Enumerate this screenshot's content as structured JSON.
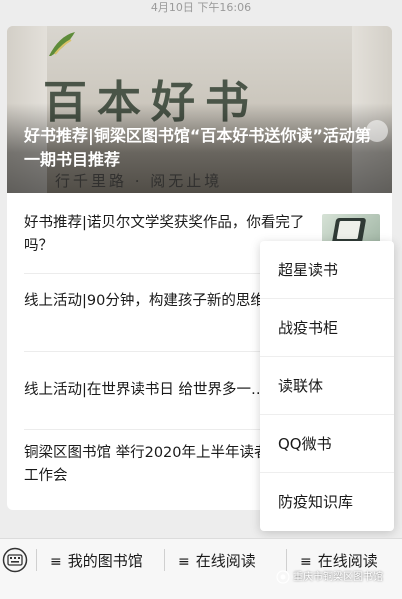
{
  "timestamp": "4月10日 下午16:06",
  "hero": {
    "image_text": "百本好书",
    "image_subtext": "行千里路 · 阅无止境",
    "title": "好书推荐|铜梁区图书馆“百本好书送你读”活动第一期书目推荐"
  },
  "articles": [
    {
      "title": "好书推荐|诺贝尔文学奖获奖作品，你看完了吗？",
      "has_thumb": true
    },
    {
      "title": "线上活动|90分钟，构建孩子新的思维方式"
    },
    {
      "title": "线上活动|在世界读书日 给世界多一…"
    },
    {
      "title": "铜梁区图书馆 举行2020年上半年读者服务工作会"
    }
  ],
  "popup_menu": {
    "items": [
      "超星读书",
      "战疫书柜",
      "读联体",
      "QQ微书",
      "防疫知识库"
    ]
  },
  "tabbar": {
    "tabs": [
      {
        "icon": "menu-icon",
        "label": "我的图书馆"
      },
      {
        "icon": "menu-icon",
        "label": "在线阅读"
      },
      {
        "icon": "menu-icon",
        "label": "在线阅读"
      }
    ]
  },
  "watermark": "重庆市铜梁区图书馆",
  "colors": {
    "background": "#ededed",
    "card": "#ffffff",
    "text": "#1a1a1a",
    "secondary_text": "#9a9a9a"
  }
}
